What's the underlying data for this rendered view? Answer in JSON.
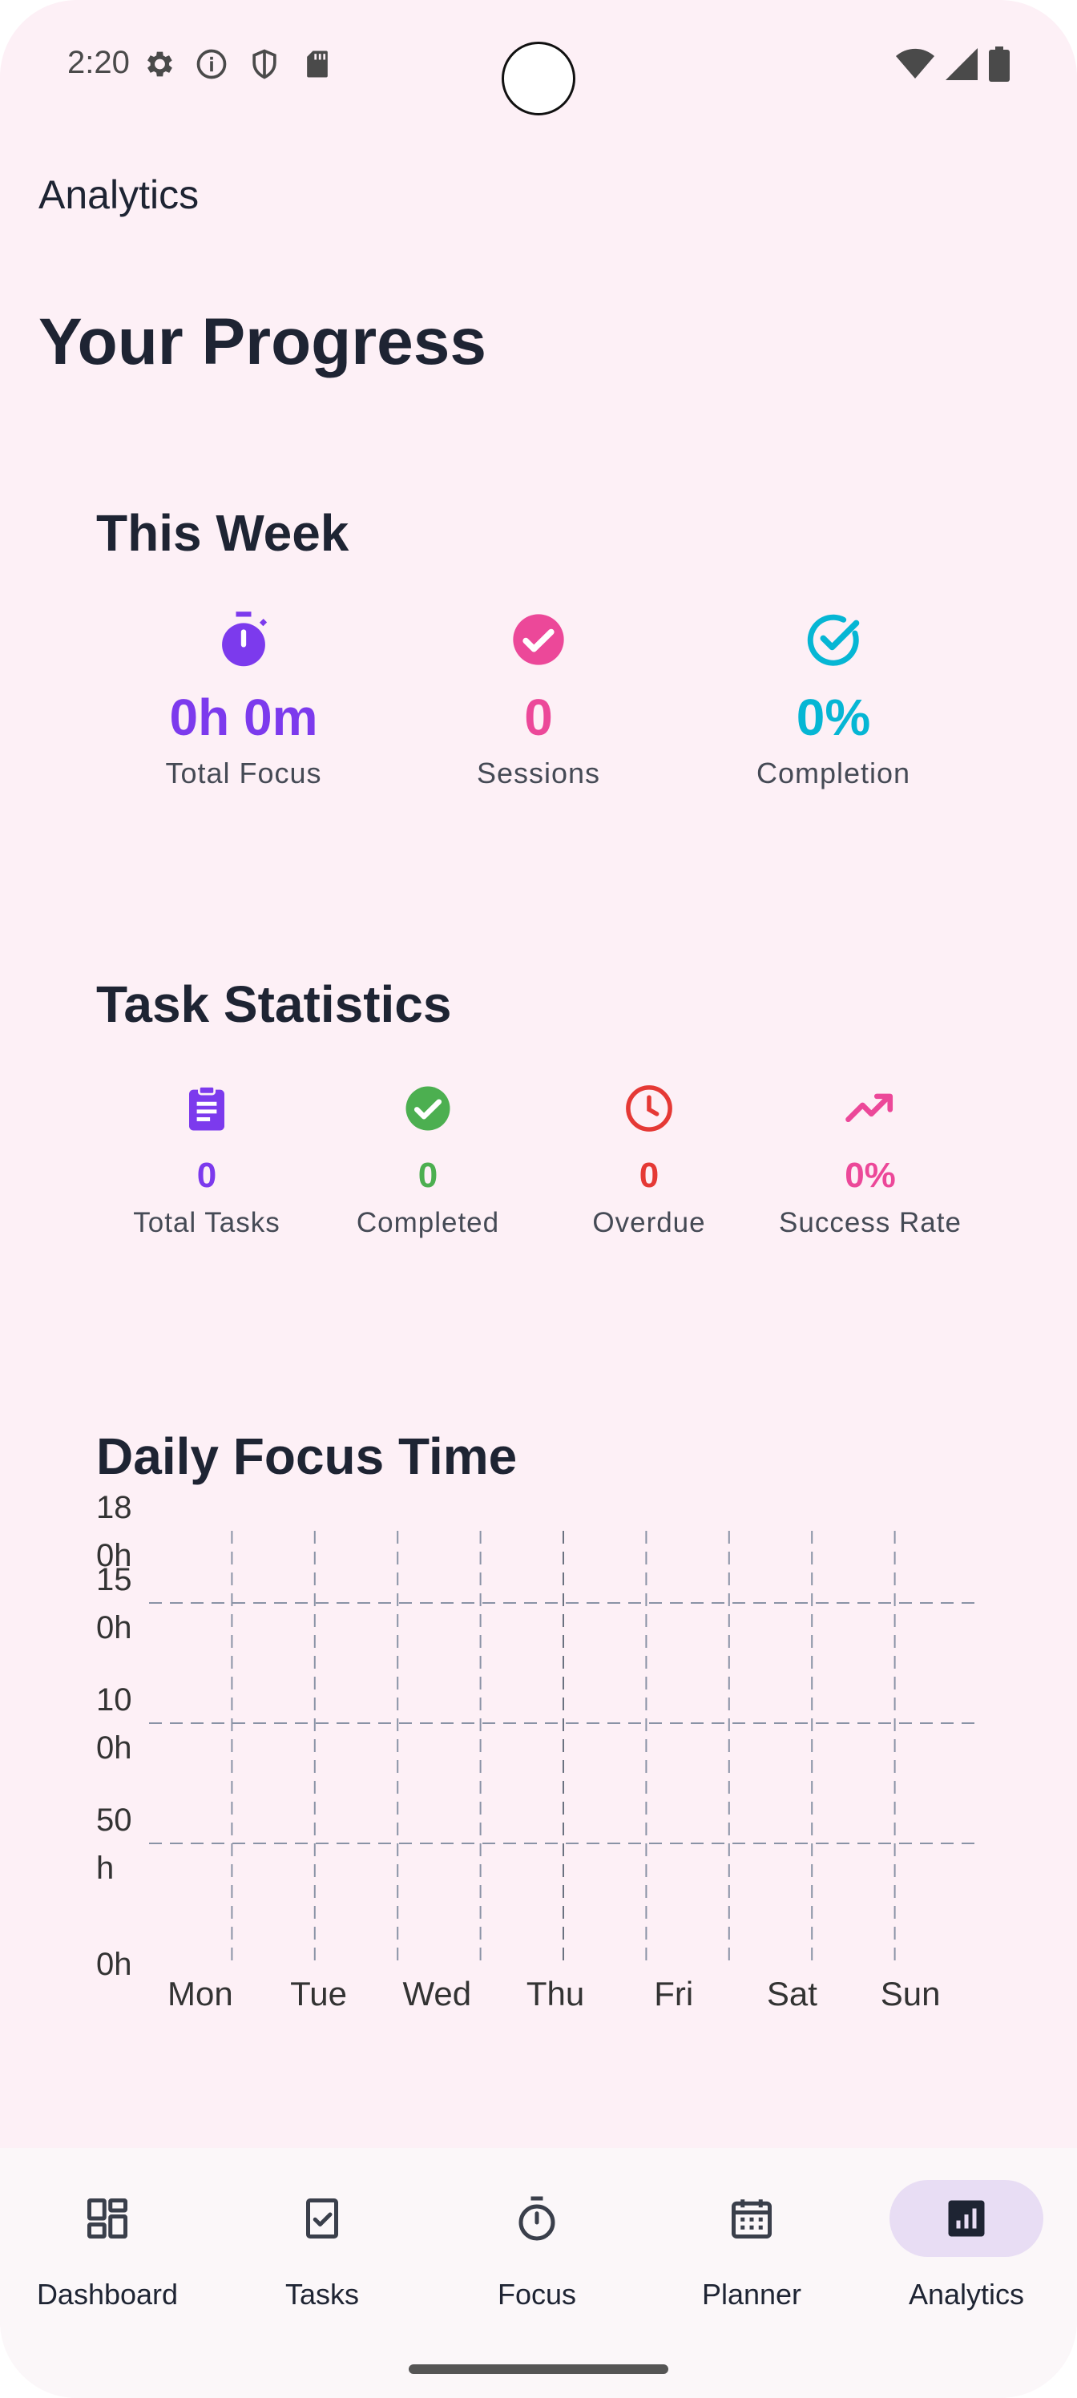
{
  "status_bar": {
    "time": "2:20"
  },
  "app_bar": {
    "title": "Analytics"
  },
  "page": {
    "heading": "Your Progress"
  },
  "this_week": {
    "title": "This Week",
    "stats": [
      {
        "value": "0h 0m",
        "label": "Total Focus",
        "icon": "timer-icon",
        "color": "#7c3aed"
      },
      {
        "value": "0",
        "label": "Sessions",
        "icon": "check-circle-filled-icon",
        "color": "#ec4899"
      },
      {
        "value": "0%",
        "label": "Completion",
        "icon": "check-circle-outline-icon",
        "color": "#06b6d4"
      }
    ]
  },
  "task_statistics": {
    "title": "Task Statistics",
    "stats": [
      {
        "value": "0",
        "label": "Total Tasks",
        "icon": "clipboard-icon",
        "color": "#7c3aed"
      },
      {
        "value": "0",
        "label": "Completed",
        "icon": "check-circle-icon",
        "color": "#4caf50"
      },
      {
        "value": "0",
        "label": "Overdue",
        "icon": "clock-icon",
        "color": "#e53935"
      },
      {
        "value": "0%",
        "label": "Success Rate",
        "icon": "trending-up-icon",
        "color": "#ec4899"
      }
    ]
  },
  "daily_focus": {
    "title": "Daily Focus Time"
  },
  "chart_data": {
    "type": "bar",
    "categories": [
      "Mon",
      "Tue",
      "Wed",
      "Thu",
      "Fri",
      "Sat",
      "Sun"
    ],
    "values": [
      0,
      0,
      0,
      0,
      0,
      0,
      0
    ],
    "title": "Daily Focus Time",
    "xlabel": "",
    "ylabel": "",
    "ylim": [
      0,
      180
    ],
    "yticks": [
      {
        "value": 0,
        "label": [
          "0h"
        ]
      },
      {
        "value": 50,
        "label": [
          "50",
          "h"
        ]
      },
      {
        "value": 100,
        "label": [
          "10",
          "0h"
        ]
      },
      {
        "value": 150,
        "label": [
          "15",
          "0h"
        ]
      },
      {
        "value": 180,
        "label": [
          "18",
          "0h"
        ]
      }
    ],
    "grid": true
  },
  "bottom_nav": {
    "items": [
      {
        "label": "Dashboard",
        "icon": "dashboard-icon",
        "active": false
      },
      {
        "label": "Tasks",
        "icon": "tasks-icon",
        "active": false
      },
      {
        "label": "Focus",
        "icon": "timer-icon",
        "active": false
      },
      {
        "label": "Planner",
        "icon": "calendar-icon",
        "active": false
      },
      {
        "label": "Analytics",
        "icon": "analytics-icon",
        "active": true
      }
    ]
  },
  "colors": {
    "background": "#fdf0f6",
    "text": "#1e2433",
    "nav_active": "#e8ddf4"
  }
}
